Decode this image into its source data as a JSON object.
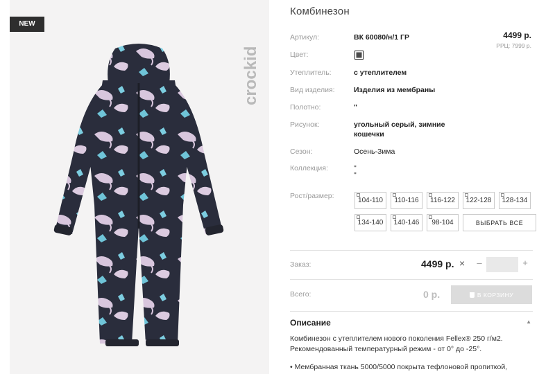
{
  "badge": "NEW",
  "brand": "crockid",
  "product": {
    "title": "Комбинезон",
    "price": "4499 р.",
    "rrp": "РРЦ: 7999 р."
  },
  "attributes": [
    {
      "label": "Артикул:",
      "value": "ВК 60080/н/1 ГР"
    },
    {
      "label": "Цвет:",
      "value": ""
    },
    {
      "label": "Утеплитель:",
      "value": "с утеплителем"
    },
    {
      "label": "Вид изделия:",
      "value": "Изделия из мембраны"
    },
    {
      "label": "Полотно:",
      "value": "\""
    },
    {
      "label": "Рисунок:",
      "value": "угольный серый, зимние",
      "value2": "кошечки"
    },
    {
      "label": "Сезон:",
      "value": "Осень-Зима"
    },
    {
      "label": "Коллекция:",
      "value": "\"",
      "value2": "\""
    },
    {
      "label": "Рост/размер:",
      "value": ""
    }
  ],
  "color_swatch": "#4a4a4a",
  "sizes": [
    "104-110",
    "110-116",
    "116-122",
    "122-128",
    "128-134",
    "134-140",
    "140-146",
    "98-104"
  ],
  "select_all": "ВЫБРАТЬ ВСЕ",
  "order": {
    "label": "Заказ:",
    "price": "4499 р.",
    "times": "×",
    "minus": "–",
    "plus": "+",
    "quantity": ""
  },
  "total": {
    "label": "Всего:",
    "price": "0 р."
  },
  "cart_button": "В КОРЗИНУ",
  "description": {
    "title": "Описание",
    "toggle": "▲",
    "text": "Комбинезон с утеплителем нового поколения Fellex® 250 г/м2. Рекомендованный температурный режим - от 0° до -25°.",
    "bullet": "• Мембранная ткань 5000/5000 покрыта тефлоновой пропиткой,"
  }
}
